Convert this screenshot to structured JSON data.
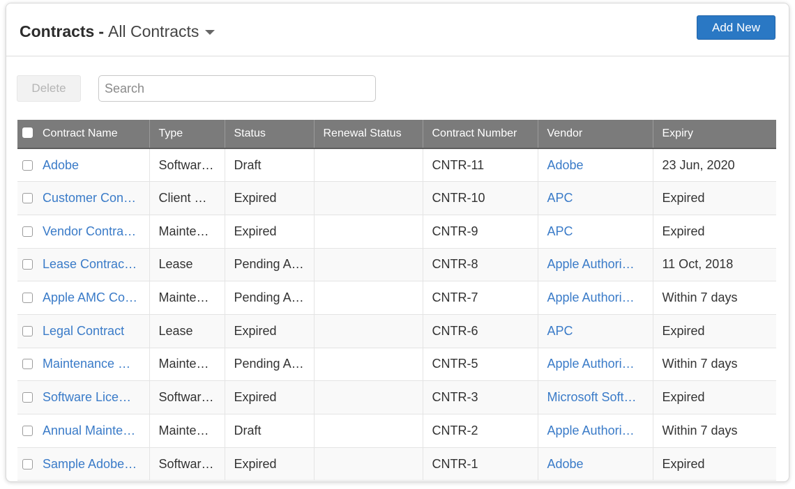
{
  "header": {
    "title_bold": "Contracts",
    "separator": "-",
    "view_name": "All Contracts",
    "add_button": "Add New"
  },
  "toolbar": {
    "delete_button": "Delete",
    "search_placeholder": "Search"
  },
  "colors": {
    "primary": "#2a78c4",
    "link": "#3a7bc8",
    "table_header": "#7b7b7b"
  },
  "table": {
    "columns": [
      "Contract Name",
      "Type",
      "Status",
      "Renewal Status",
      "Contract Number",
      "Vendor",
      "Expiry"
    ],
    "rows": [
      {
        "name": "Adobe",
        "type": "Softwar…",
        "status": "Draft",
        "renewal": "",
        "number": "CNTR-11",
        "vendor": "Adobe",
        "expiry": "23 Jun, 2020"
      },
      {
        "name": "Customer Con…",
        "type": "Client C…",
        "status": "Expired",
        "renewal": "",
        "number": "CNTR-10",
        "vendor": "APC",
        "expiry": "Expired"
      },
      {
        "name": "Vendor Contra…",
        "type": "Mainte…",
        "status": "Expired",
        "renewal": "",
        "number": "CNTR-9",
        "vendor": "APC",
        "expiry": "Expired"
      },
      {
        "name": "Lease Contrac…",
        "type": "Lease",
        "status": "Pending A…",
        "renewal": "",
        "number": "CNTR-8",
        "vendor": "Apple Authori…",
        "expiry": "11 Oct, 2018"
      },
      {
        "name": "Apple AMC Co…",
        "type": "Mainte…",
        "status": "Pending A…",
        "renewal": "",
        "number": "CNTR-7",
        "vendor": "Apple Authori…",
        "expiry": "Within 7 days"
      },
      {
        "name": "Legal Contract",
        "type": "Lease",
        "status": "Expired",
        "renewal": "",
        "number": "CNTR-6",
        "vendor": "APC",
        "expiry": "Expired"
      },
      {
        "name": "Maintenance …",
        "type": "Mainte…",
        "status": "Pending A…",
        "renewal": "",
        "number": "CNTR-5",
        "vendor": "Apple Authori…",
        "expiry": "Within 7 days"
      },
      {
        "name": "Software Lice…",
        "type": "Softwar…",
        "status": "Expired",
        "renewal": "",
        "number": "CNTR-3",
        "vendor": "Microsoft Soft…",
        "expiry": "Expired"
      },
      {
        "name": "Annual Mainte…",
        "type": "Mainte…",
        "status": "Draft",
        "renewal": "",
        "number": "CNTR-2",
        "vendor": "Apple Authori…",
        "expiry": "Within 7 days"
      },
      {
        "name": "Sample Adobe…",
        "type": "Softwar…",
        "status": "Expired",
        "renewal": "",
        "number": "CNTR-1",
        "vendor": "Adobe",
        "expiry": "Expired"
      }
    ]
  }
}
